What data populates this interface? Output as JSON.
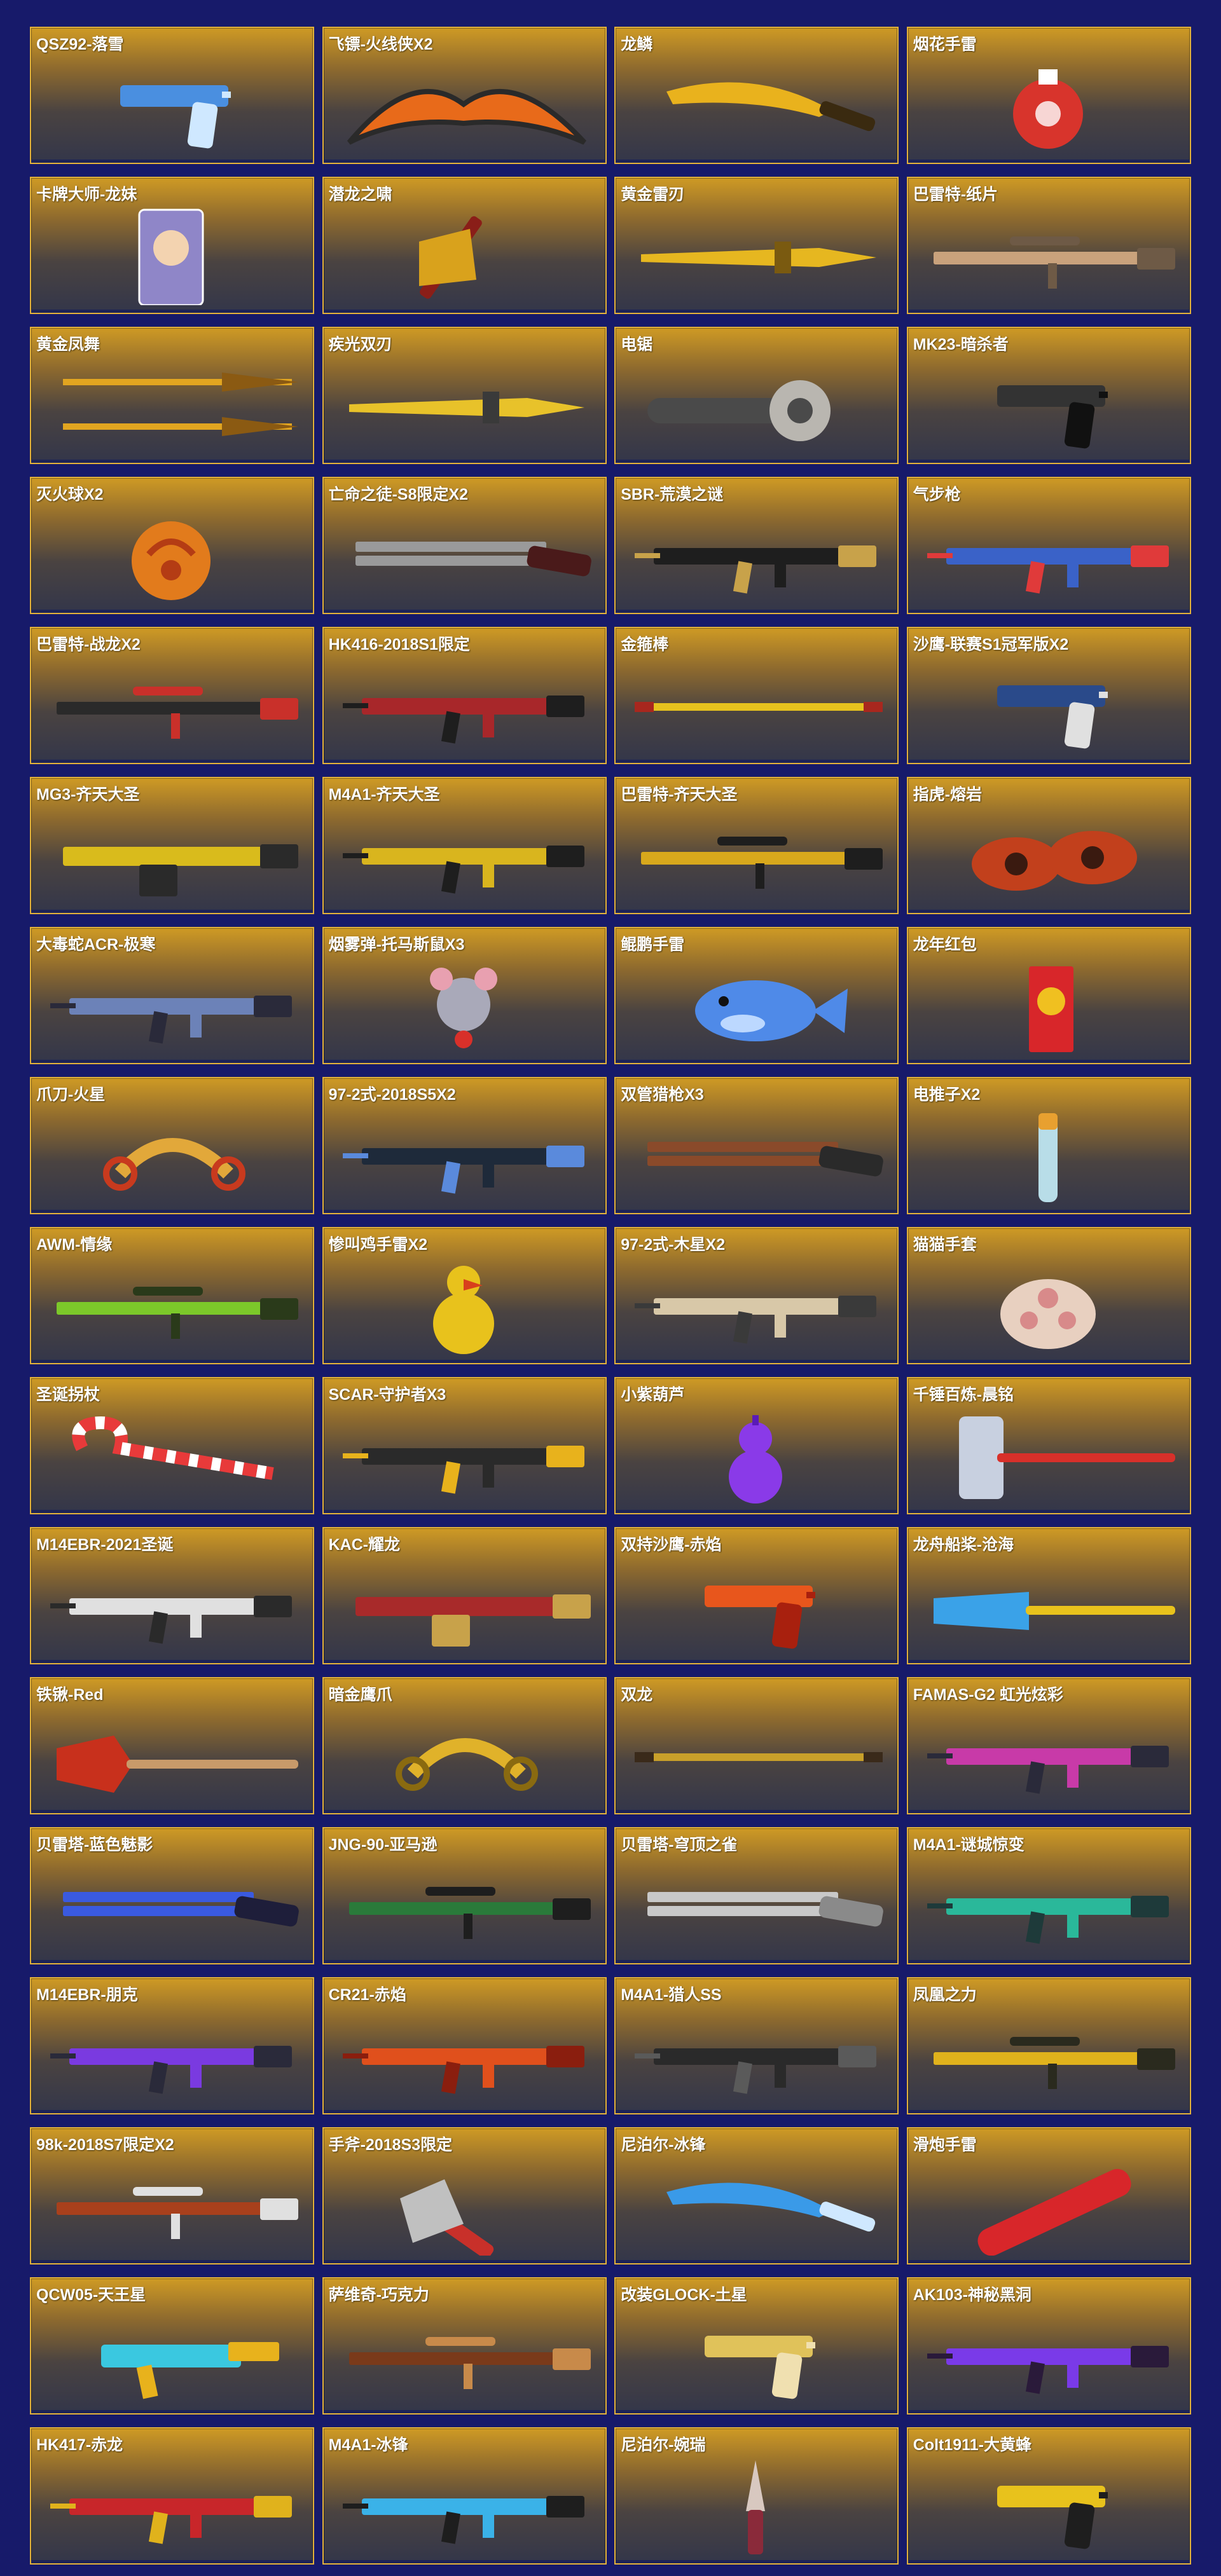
{
  "colors": {
    "page_background": "#171a6a",
    "card_border": "#e3b23a",
    "label_text": "#ffffff"
  },
  "items": [
    {
      "name": "QSZ92-落雪",
      "kind": "pistol",
      "colors": [
        "#4a8fe0",
        "#cfe8ff"
      ]
    },
    {
      "name": "飞镖-火线侠X2",
      "kind": "batwing",
      "colors": [
        "#e86a1a",
        "#2a2a2a"
      ]
    },
    {
      "name": "龙鳞",
      "kind": "knife",
      "colors": [
        "#e9b21d",
        "#3a2a10"
      ]
    },
    {
      "name": "烟花手雷",
      "kind": "grenade",
      "colors": [
        "#d8342c",
        "#ffffff"
      ]
    },
    {
      "name": "卡牌大师-龙妹",
      "kind": "card",
      "colors": [
        "#8f86c8",
        "#f3d3b0"
      ]
    },
    {
      "name": "潜龙之啸",
      "kind": "axe",
      "colors": [
        "#d9a21c",
        "#8a1e18"
      ]
    },
    {
      "name": "黄金雷刃",
      "kind": "blade",
      "colors": [
        "#e6b720",
        "#7a5a10"
      ]
    },
    {
      "name": "巴雷特-纸片",
      "kind": "sniper",
      "colors": [
        "#c9a27c",
        "#6e5a46"
      ]
    },
    {
      "name": "黄金凤舞",
      "kind": "spears",
      "colors": [
        "#e2a520",
        "#8b5a12"
      ]
    },
    {
      "name": "疾光双刃",
      "kind": "blade",
      "colors": [
        "#e8c22a",
        "#3a3a3a"
      ]
    },
    {
      "name": "电锯",
      "kind": "chainsaw",
      "colors": [
        "#b9b6b0",
        "#4a4a4a"
      ]
    },
    {
      "name": "MK23-暗杀者",
      "kind": "pistol",
      "colors": [
        "#333333",
        "#111111"
      ]
    },
    {
      "name": "灭火球X2",
      "kind": "ball",
      "colors": [
        "#e27b1c",
        "#b43c14"
      ]
    },
    {
      "name": "亡命之徒-S8限定X2",
      "kind": "shotgun",
      "colors": [
        "#9a9a9a",
        "#4a1a1a"
      ]
    },
    {
      "name": "SBR-荒漠之谜",
      "kind": "rifle",
      "colors": [
        "#1e1e1e",
        "#c8a24a"
      ]
    },
    {
      "name": "气步枪",
      "kind": "rifle",
      "colors": [
        "#3a62c8",
        "#e03a3a"
      ]
    },
    {
      "name": "巴雷特-战龙X2",
      "kind": "sniper",
      "colors": [
        "#2a2a2a",
        "#c9302a"
      ]
    },
    {
      "name": "HK416-2018S1限定",
      "kind": "rifle",
      "colors": [
        "#a8272a",
        "#1e1e1e"
      ]
    },
    {
      "name": "金箍棒",
      "kind": "staff",
      "colors": [
        "#e6c21e",
        "#a8271e"
      ]
    },
    {
      "name": "沙鹰-联赛S1冠军版X2",
      "kind": "pistol",
      "colors": [
        "#2a4a8a",
        "#e0e0e0"
      ]
    },
    {
      "name": "MG3-齐天大圣",
      "kind": "mg",
      "colors": [
        "#d9bb1c",
        "#2a2a2a"
      ]
    },
    {
      "name": "M4A1-齐天大圣",
      "kind": "rifle",
      "colors": [
        "#d9b51e",
        "#1e1e1e"
      ]
    },
    {
      "name": "巴雷特-齐天大圣",
      "kind": "sniper",
      "colors": [
        "#d8a81c",
        "#1e1e1e"
      ]
    },
    {
      "name": "指虎-熔岩",
      "kind": "knuckles",
      "colors": [
        "#c2401c",
        "#3a1a10"
      ]
    },
    {
      "name": "大毒蛇ACR-极寒",
      "kind": "rifle",
      "colors": [
        "#6c82b8",
        "#2a2a3a"
      ]
    },
    {
      "name": "烟雾弹-托马斯鼠X3",
      "kind": "mouse",
      "colors": [
        "#a9a9b9",
        "#e8a0b0"
      ]
    },
    {
      "name": "鲲鹏手雷",
      "kind": "fish",
      "colors": [
        "#4f8ae8",
        "#bcd8ff"
      ]
    },
    {
      "name": "龙年红包",
      "kind": "envelope",
      "colors": [
        "#d8262a",
        "#f0c020"
      ]
    },
    {
      "name": "爪刀-火星",
      "kind": "karambit",
      "colors": [
        "#e2a83a",
        "#c83a1e"
      ]
    },
    {
      "name": "97-2式-2018S5X2",
      "kind": "rifle",
      "colors": [
        "#1e2a3a",
        "#5a8adc"
      ]
    },
    {
      "name": "双管猎枪X3",
      "kind": "shotgun",
      "colors": [
        "#8a4a2a",
        "#2a2a2a"
      ]
    },
    {
      "name": "电推子X2",
      "kind": "clipper",
      "colors": [
        "#b8dde8",
        "#e8a030"
      ]
    },
    {
      "name": "AWM-情缘",
      "kind": "sniper",
      "colors": [
        "#7cc82a",
        "#2a3a1a"
      ]
    },
    {
      "name": "惨叫鸡手雷X2",
      "kind": "chicken",
      "colors": [
        "#e8c21c",
        "#d8401c"
      ]
    },
    {
      "name": "97-2式-木星X2",
      "kind": "rifle",
      "colors": [
        "#d8c8a8",
        "#3a3a3a"
      ]
    },
    {
      "name": "猫猫手套",
      "kind": "paw",
      "colors": [
        "#e8d0c0",
        "#d88a8a"
      ]
    },
    {
      "name": "圣诞拐杖",
      "kind": "candycane",
      "colors": [
        "#e83a3a",
        "#ffffff"
      ]
    },
    {
      "name": "SCAR-守护者X3",
      "kind": "rifle",
      "colors": [
        "#2a2a2a",
        "#e8b21c"
      ]
    },
    {
      "name": "小紫葫芦",
      "kind": "gourd",
      "colors": [
        "#8a3ae8",
        "#5a1ab8"
      ]
    },
    {
      "name": "千锤百炼-晨铭",
      "kind": "hammer",
      "colors": [
        "#c8d0e0",
        "#d8302a"
      ]
    },
    {
      "name": "M14EBR-2021圣诞",
      "kind": "rifle",
      "colors": [
        "#e0e0e0",
        "#2a2a2a"
      ]
    },
    {
      "name": "KAC-耀龙",
      "kind": "mg",
      "colors": [
        "#a82a2a",
        "#c8a24a"
      ]
    },
    {
      "name": "双持沙鹰-赤焰",
      "kind": "pistol",
      "colors": [
        "#e8561c",
        "#a8200e"
      ]
    },
    {
      "name": "龙舟船桨-沧海",
      "kind": "paddle",
      "colors": [
        "#3aa2e8",
        "#e8c21c"
      ]
    },
    {
      "name": "铁锹-Red",
      "kind": "shovel",
      "colors": [
        "#c8301c",
        "#c89a6a"
      ]
    },
    {
      "name": "暗金鹰爪",
      "kind": "karambit",
      "colors": [
        "#e0b22a",
        "#8a6a10"
      ]
    },
    {
      "name": "双龙",
      "kind": "staff",
      "colors": [
        "#c8a02a",
        "#3a2a1a"
      ]
    },
    {
      "name": "FAMAS-G2 虹光炫彩",
      "kind": "rifle",
      "colors": [
        "#c83aa8",
        "#2a2a3a"
      ]
    },
    {
      "name": "贝雷塔-蓝色魅影",
      "kind": "shotgun",
      "colors": [
        "#3a5ae0",
        "#1e1e3a"
      ]
    },
    {
      "name": "JNG-90-亚马逊",
      "kind": "sniper",
      "colors": [
        "#2a7a3a",
        "#1e1e1e"
      ]
    },
    {
      "name": "贝雷塔-穹顶之雀",
      "kind": "shotgun",
      "colors": [
        "#c8c8c8",
        "#8a8a8a"
      ]
    },
    {
      "name": "M4A1-谜城惊变",
      "kind": "rifle",
      "colors": [
        "#2ab89a",
        "#1e3a3a"
      ]
    },
    {
      "name": "M14EBR-朋克",
      "kind": "rifle",
      "colors": [
        "#7a3ae0",
        "#2a2a3a"
      ]
    },
    {
      "name": "CR21-赤焰",
      "kind": "rifle",
      "colors": [
        "#e0501c",
        "#8a1e0e"
      ]
    },
    {
      "name": "M4A1-猎人SS",
      "kind": "rifle",
      "colors": [
        "#2a2a2a",
        "#5a5a5a"
      ]
    },
    {
      "name": "凤凰之力",
      "kind": "sniper",
      "colors": [
        "#e0b21c",
        "#2a2a1e"
      ]
    },
    {
      "name": "98k-2018S7限定X2",
      "kind": "sniper",
      "colors": [
        "#a8401c",
        "#e0e0e0"
      ]
    },
    {
      "name": "手斧-2018S3限定",
      "kind": "hatchet",
      "colors": [
        "#c0c0c0",
        "#c8302a"
      ]
    },
    {
      "name": "尼泊尔-冰锋",
      "kind": "knife",
      "colors": [
        "#3a9ae8",
        "#cfe8ff"
      ]
    },
    {
      "name": "滑炮手雷",
      "kind": "firecracker",
      "colors": [
        "#d8262a",
        "#f0c020"
      ]
    },
    {
      "name": "QCW05-天王星",
      "kind": "smg",
      "colors": [
        "#3ac8e0",
        "#e8b21c"
      ]
    },
    {
      "name": "萨维奇-巧克力",
      "kind": "sniper",
      "colors": [
        "#7a3a1a",
        "#c88a4a"
      ]
    },
    {
      "name": "改装GLOCK-土星",
      "kind": "pistol",
      "colors": [
        "#e0c25a",
        "#f0e0b0"
      ]
    },
    {
      "name": "AK103-神秘黑洞",
      "kind": "rifle",
      "colors": [
        "#7a3ae8",
        "#2a1a3a"
      ]
    },
    {
      "name": "HK417-赤龙",
      "kind": "rifle",
      "colors": [
        "#c8262a",
        "#e0b21c"
      ]
    },
    {
      "name": "M4A1-冰锋",
      "kind": "rifle",
      "colors": [
        "#3ab2e8",
        "#1e1e1e"
      ]
    },
    {
      "name": "尼泊尔-婉瑞",
      "kind": "dagger",
      "colors": [
        "#d8c8c0",
        "#8a2a3a"
      ]
    },
    {
      "name": "Colt1911-大黄蜂",
      "kind": "pistol",
      "colors": [
        "#e8c21c",
        "#1e1e1e"
      ]
    }
  ]
}
